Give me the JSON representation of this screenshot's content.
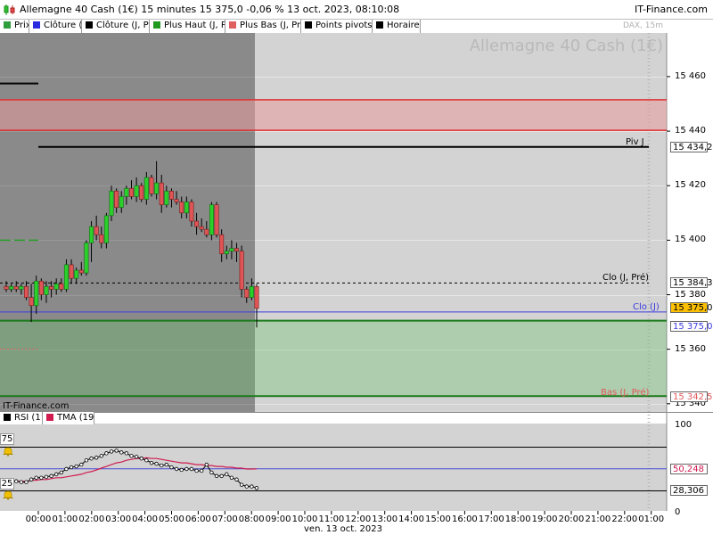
{
  "window": {
    "title": "Allemagne 40 Cash (1€) 15 minutes 15 375,0 -0,06 % 13 oct. 2023, 08:10:08",
    "brand": "IT-Finance.com"
  },
  "legend": [
    {
      "label": "Prix",
      "color": "#2e9e3e"
    },
    {
      "label": "Clôture (J",
      "color": "#2a2ae0"
    },
    {
      "label": "Clôture (J, Pré",
      "color": "#000000"
    },
    {
      "label": "Plus Haut (J, Pr",
      "color": "#1f9a1f"
    },
    {
      "label": "Plus Bas (J, Pr",
      "color": "#e06060"
    },
    {
      "label": "Points pivots (",
      "color": "#000000"
    },
    {
      "label": "Horaires",
      "color": "#000000"
    }
  ],
  "watermark": {
    "main": "Allemagne 40 Cash (1€)",
    "sub": "DAX, 15m"
  },
  "chart_brand": "IT-Finance.com",
  "price_axis": {
    "ticks": [
      "15 460",
      "15 440",
      "15 420",
      "15 400",
      "15 380",
      "15 360",
      "15 340"
    ],
    "tick_values": [
      15460,
      15440,
      15420,
      15400,
      15380,
      15360,
      15340
    ],
    "range": [
      15337,
      15476
    ]
  },
  "levels": {
    "pivot": {
      "label": "Piv J",
      "value": "15 434,2",
      "num": 15434.2
    },
    "prev_close": {
      "label": "Clo (J, Pré)",
      "value": "15 384,3",
      "num": 15384.3
    },
    "last_price": {
      "value": "15 375,0",
      "num": 15375.0,
      "color": "#ffc000"
    },
    "close_today": {
      "label": "Clo (J)",
      "value": "15 375,0",
      "num": 15375.0
    },
    "prev_low": {
      "label": "Bas (J, Pré)",
      "value": "15 342,5",
      "num": 15342.5
    }
  },
  "rsi_legend": [
    {
      "label": "RSI (11",
      "color": "#000000"
    },
    {
      "label": "TMA (19)",
      "color": "#d01c50"
    }
  ],
  "rsi_axis": {
    "ticks": [
      "100",
      "0"
    ],
    "levels": [
      "75",
      "25"
    ],
    "range": [
      0,
      100
    ]
  },
  "rsi_values": {
    "rsi": "28,306",
    "tma": "50,248"
  },
  "time_axis": {
    "labels": [
      "00:00",
      "01:00",
      "02:00",
      "03:00",
      "04:00",
      "05:00",
      "06:00",
      "07:00",
      "08:00",
      "09:00",
      "10:00",
      "11:00",
      "12:00",
      "13:00",
      "14:00",
      "15:00",
      "16:00",
      "17:00",
      "18:00",
      "19:00",
      "20:00",
      "21:00",
      "22:00",
      "01:00"
    ],
    "date": "ven. 13 oct. 2023"
  },
  "chart_data": {
    "type": "candlestick",
    "interval": "15 minutes",
    "candles": [
      {
        "o": 15383,
        "h": 15385,
        "l": 15381,
        "c": 15382
      },
      {
        "o": 15382,
        "h": 15384,
        "l": 15381,
        "c": 15383
      },
      {
        "o": 15383,
        "h": 15385,
        "l": 15381,
        "c": 15382
      },
      {
        "o": 15382,
        "h": 15384,
        "l": 15380,
        "c": 15383
      },
      {
        "o": 15383,
        "h": 15385,
        "l": 15378,
        "c": 15379
      },
      {
        "o": 15379,
        "h": 15384,
        "l": 15370,
        "c": 15376
      },
      {
        "o": 15376,
        "h": 15387,
        "l": 15373,
        "c": 15385
      },
      {
        "o": 15385,
        "h": 15386,
        "l": 15378,
        "c": 15380
      },
      {
        "o": 15380,
        "h": 15385,
        "l": 15377,
        "c": 15383
      },
      {
        "o": 15383,
        "h": 15385,
        "l": 15379,
        "c": 15382
      },
      {
        "o": 15382,
        "h": 15386,
        "l": 15380,
        "c": 15384
      },
      {
        "o": 15384,
        "h": 15386,
        "l": 15381,
        "c": 15382
      },
      {
        "o": 15382,
        "h": 15393,
        "l": 15381,
        "c": 15391
      },
      {
        "o": 15391,
        "h": 15393,
        "l": 15384,
        "c": 15386
      },
      {
        "o": 15386,
        "h": 15390,
        "l": 15384,
        "c": 15389
      },
      {
        "o": 15389,
        "h": 15392,
        "l": 15387,
        "c": 15388
      },
      {
        "o": 15388,
        "h": 15400,
        "l": 15387,
        "c": 15399
      },
      {
        "o": 15399,
        "h": 15407,
        "l": 15392,
        "c": 15405
      },
      {
        "o": 15405,
        "h": 15409,
        "l": 15400,
        "c": 15402
      },
      {
        "o": 15402,
        "h": 15405,
        "l": 15397,
        "c": 15399
      },
      {
        "o": 15399,
        "h": 15410,
        "l": 15397,
        "c": 15409
      },
      {
        "o": 15409,
        "h": 15420,
        "l": 15407,
        "c": 15418
      },
      {
        "o": 15418,
        "h": 15419,
        "l": 15410,
        "c": 15412
      },
      {
        "o": 15412,
        "h": 15418,
        "l": 15410,
        "c": 15416
      },
      {
        "o": 15416,
        "h": 15420,
        "l": 15413,
        "c": 15419
      },
      {
        "o": 15419,
        "h": 15422,
        "l": 15415,
        "c": 15416
      },
      {
        "o": 15416,
        "h": 15423,
        "l": 15414,
        "c": 15420
      },
      {
        "o": 15420,
        "h": 15421,
        "l": 15414,
        "c": 15415
      },
      {
        "o": 15415,
        "h": 15425,
        "l": 15413,
        "c": 15423
      },
      {
        "o": 15423,
        "h": 15424,
        "l": 15416,
        "c": 15417
      },
      {
        "o": 15417,
        "h": 15429,
        "l": 15415,
        "c": 15421
      },
      {
        "o": 15421,
        "h": 15424,
        "l": 15410,
        "c": 15413
      },
      {
        "o": 15413,
        "h": 15420,
        "l": 15412,
        "c": 15418
      },
      {
        "o": 15418,
        "h": 15419,
        "l": 15412,
        "c": 15415
      },
      {
        "o": 15415,
        "h": 15418,
        "l": 15413,
        "c": 15414
      },
      {
        "o": 15414,
        "h": 15416,
        "l": 15408,
        "c": 15410
      },
      {
        "o": 15410,
        "h": 15416,
        "l": 15408,
        "c": 15414
      },
      {
        "o": 15414,
        "h": 15415,
        "l": 15405,
        "c": 15407
      },
      {
        "o": 15407,
        "h": 15410,
        "l": 15402,
        "c": 15405
      },
      {
        "o": 15405,
        "h": 15408,
        "l": 15403,
        "c": 15404
      },
      {
        "o": 15404,
        "h": 15407,
        "l": 15401,
        "c": 15402
      },
      {
        "o": 15402,
        "h": 15414,
        "l": 15400,
        "c": 15413
      },
      {
        "o": 15413,
        "h": 15414,
        "l": 15401,
        "c": 15402
      },
      {
        "o": 15402,
        "h": 15404,
        "l": 15392,
        "c": 15395
      },
      {
        "o": 15395,
        "h": 15398,
        "l": 15393,
        "c": 15396
      },
      {
        "o": 15396,
        "h": 15400,
        "l": 15393,
        "c": 15397
      },
      {
        "o": 15397,
        "h": 15399,
        "l": 15392,
        "c": 15396
      },
      {
        "o": 15396,
        "h": 15398,
        "l": 15379,
        "c": 15382
      },
      {
        "o": 15382,
        "h": 15383,
        "l": 15377,
        "c": 15379
      },
      {
        "o": 15379,
        "h": 15386,
        "l": 15378,
        "c": 15383
      },
      {
        "o": 15383,
        "h": 15384,
        "l": 15368,
        "c": 15375
      }
    ],
    "rsi": [
      36,
      36,
      36,
      35,
      35,
      38,
      40,
      40,
      41,
      42,
      44,
      46,
      50,
      52,
      53,
      55,
      60,
      62,
      63,
      65,
      68,
      70,
      71,
      69,
      68,
      65,
      64,
      62,
      60,
      57,
      56,
      54,
      55,
      52,
      50,
      49,
      50,
      50,
      48,
      48,
      55,
      46,
      42,
      42,
      44,
      40,
      38,
      32,
      30,
      30,
      28.306
    ],
    "tma": [
      36,
      36,
      36,
      36,
      36,
      37,
      37,
      38,
      38,
      39,
      40,
      40,
      41,
      42,
      43,
      44,
      46,
      47,
      49,
      51,
      53,
      55,
      57,
      58,
      60,
      61,
      62,
      62,
      63,
      62,
      62,
      61,
      60,
      59,
      58,
      57,
      57,
      56,
      55,
      55,
      54,
      54,
      53,
      53,
      52,
      52,
      51,
      51,
      50,
      50,
      50.248
    ]
  }
}
